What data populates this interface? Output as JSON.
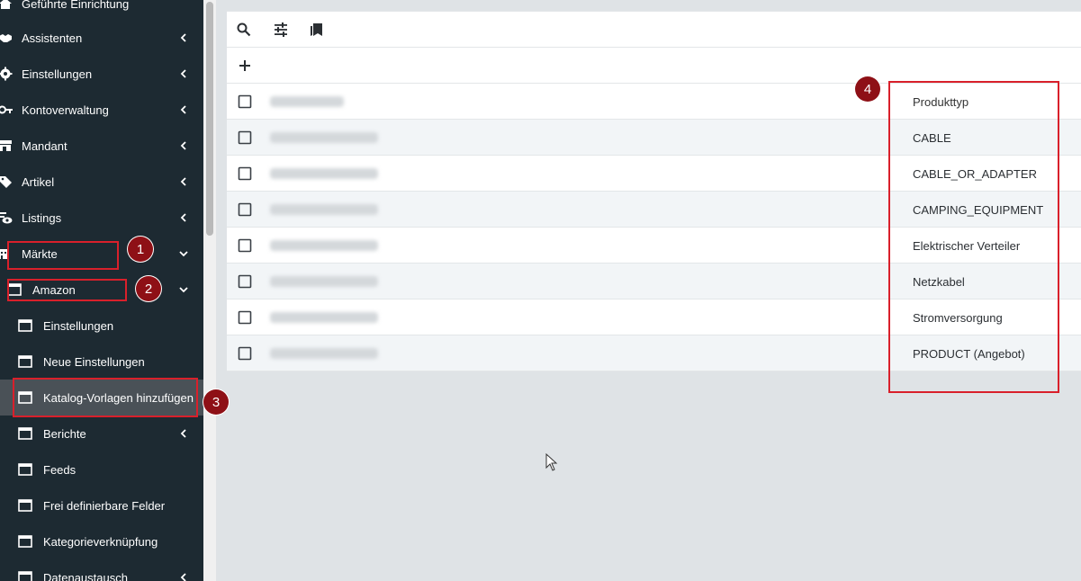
{
  "sidebar": {
    "items": [
      {
        "label": "Geführte Einrichtung",
        "icon": "home-icon"
      },
      {
        "label": "Assistenten",
        "icon": "handshake-icon"
      },
      {
        "label": "Einstellungen",
        "icon": "gear-icon"
      },
      {
        "label": "Kontoverwaltung",
        "icon": "key-icon"
      },
      {
        "label": "Mandant",
        "icon": "store-icon"
      },
      {
        "label": "Artikel",
        "icon": "tag-icon"
      },
      {
        "label": "Listings",
        "icon": "eye-icon"
      },
      {
        "label": "Märkte",
        "icon": "market-icon"
      },
      {
        "label": "Amazon",
        "icon": "window-icon"
      },
      {
        "label": "Einstellungen",
        "icon": "window-icon"
      },
      {
        "label": "Neue Einstellungen",
        "icon": "window-icon"
      },
      {
        "label": "Katalog-Vorlagen hinzufügen",
        "icon": "window-icon"
      },
      {
        "label": "Berichte",
        "icon": "window-icon"
      },
      {
        "label": "Feeds",
        "icon": "window-icon"
      },
      {
        "label": "Frei definierbare Felder",
        "icon": "window-icon"
      },
      {
        "label": "Kategorieverknüpfung",
        "icon": "window-icon"
      },
      {
        "label": "Datenaustausch",
        "icon": "window-icon"
      }
    ]
  },
  "toolbar": {
    "icons": [
      "search-icon",
      "tune-icon",
      "bookmarks-icon"
    ],
    "add_icon": "plus-icon"
  },
  "table": {
    "header": "Produkttyp",
    "rows": [
      "CABLE",
      "CABLE_OR_ADAPTER",
      "CAMPING_EQUIPMENT",
      "Elektrischer Verteiler",
      "Netzkabel",
      "Stromversorgung",
      "PRODUCT (Angebot)"
    ]
  },
  "annotations": {
    "badges": [
      "1",
      "2",
      "3",
      "4"
    ],
    "color": "#d9202b",
    "badge_color": "#8e1016"
  },
  "colors": {
    "sidebar_bg": "#1d2a32",
    "active_bg": "#4a5157",
    "content_bg": "#dfe3e6"
  }
}
